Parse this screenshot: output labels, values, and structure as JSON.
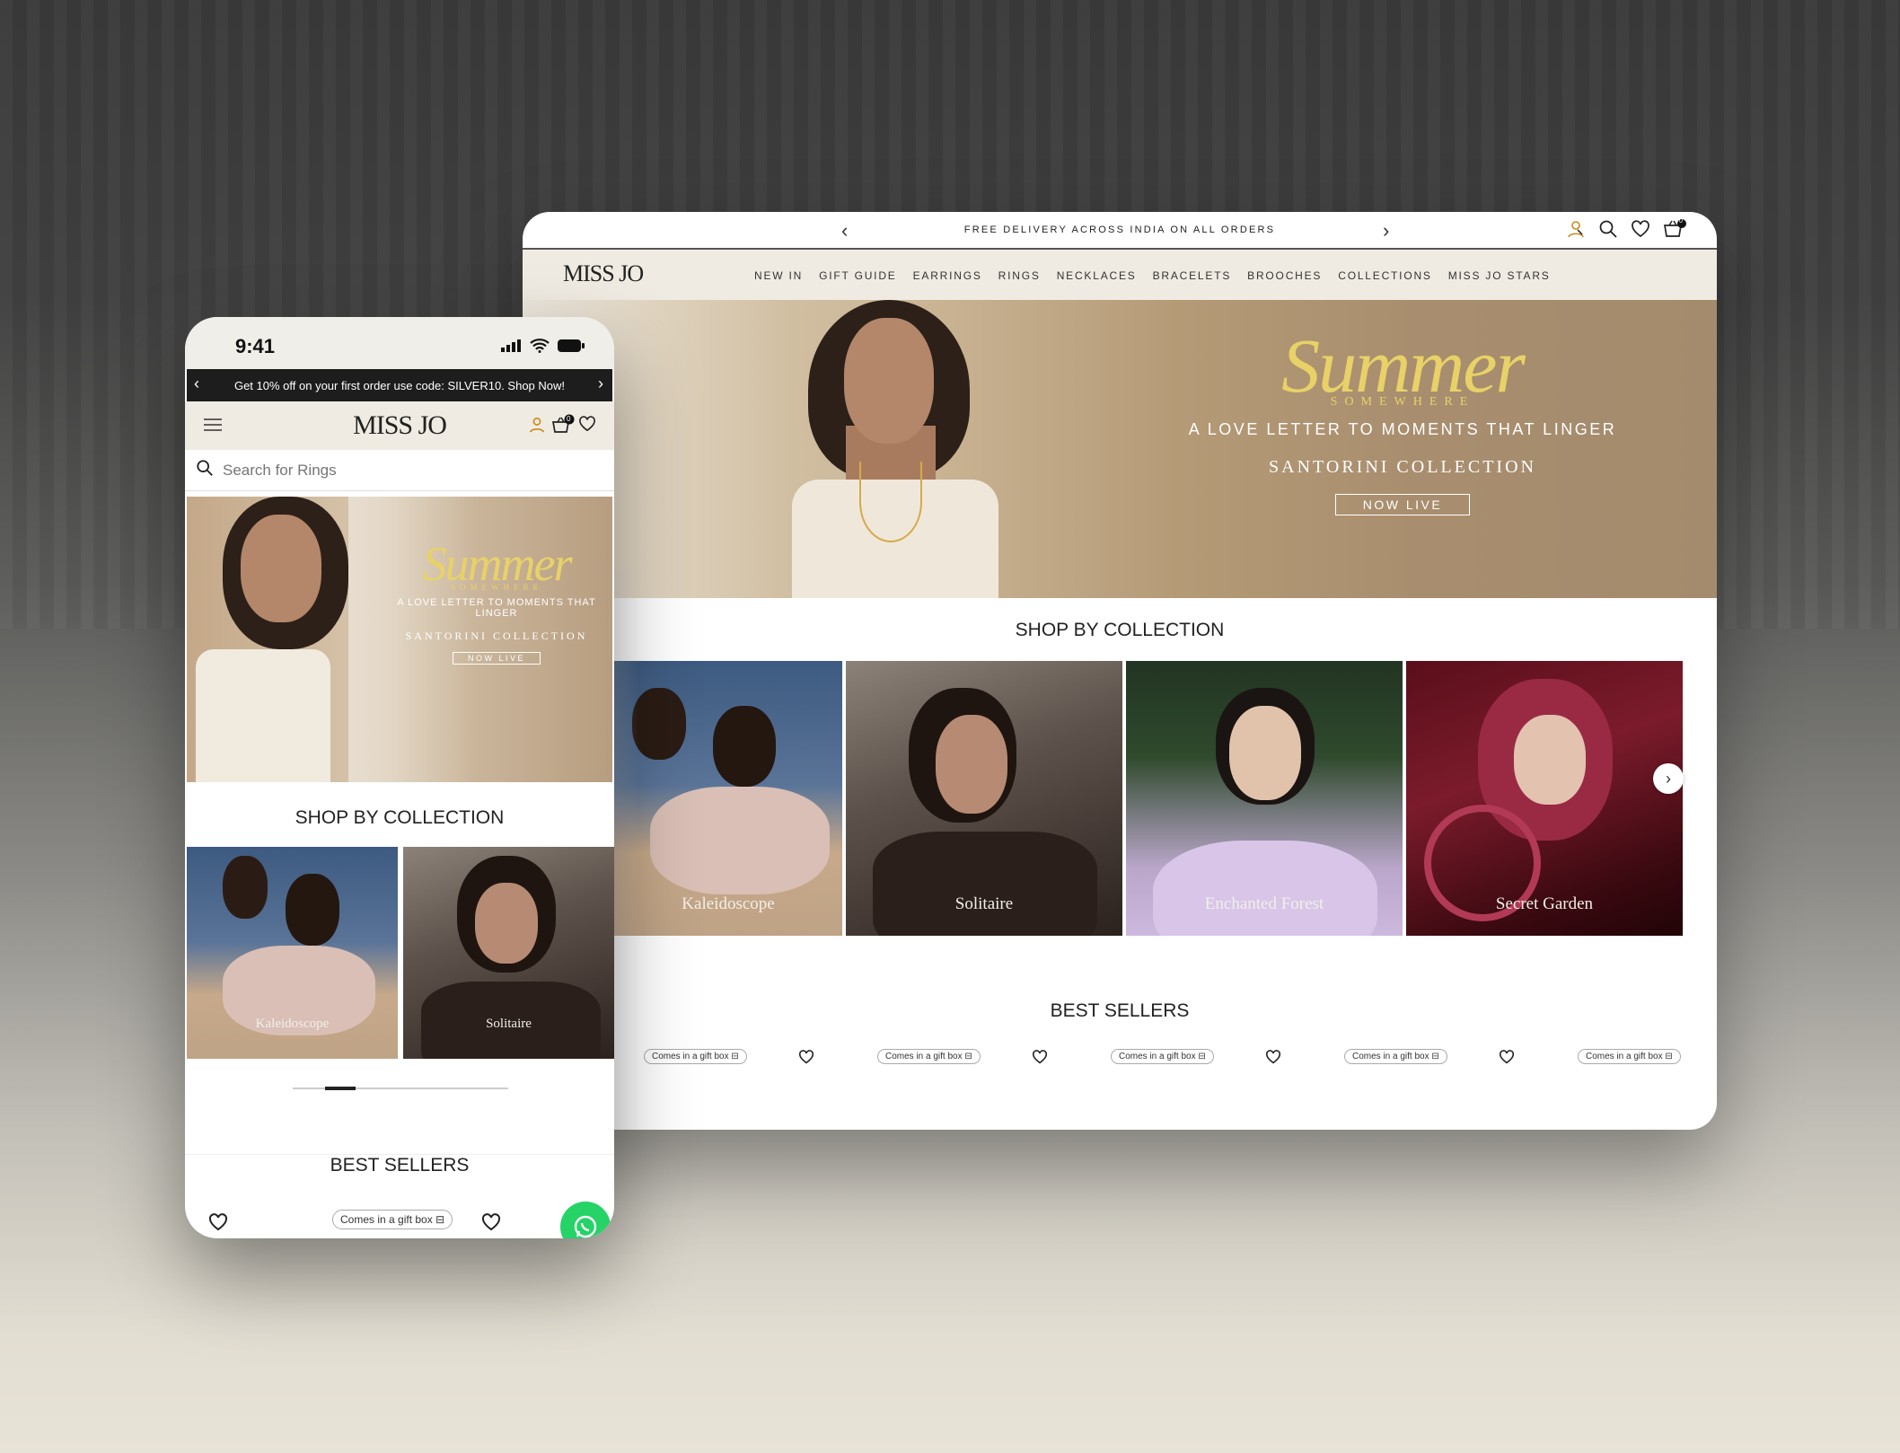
{
  "desktop": {
    "announcement": "FREE DELIVERY ACROSS INDIA ON ALL ORDERS",
    "prev_arrow": "‹",
    "next_arrow": "›",
    "cart_count": "0",
    "logo": "MISS JO",
    "menu": [
      "NEW IN",
      "GIFT GUIDE",
      "EARRINGS",
      "RINGS",
      "NECKLACES",
      "BRACELETS",
      "BROOCHES",
      "COLLECTIONS",
      "MISS JO STARS"
    ],
    "hero": {
      "script_title": "Summer",
      "script_sub": "SOMEWHERE",
      "tagline": "A LOVE LETTER TO MOMENTS THAT LINGER",
      "collection": "SANTORINI COLLECTION",
      "cta": "NOW LIVE"
    },
    "shop_by_collection": "SHOP BY COLLECTION",
    "collections": [
      "Kaleidoscope",
      "Solitaire",
      "Enchanted Forest",
      "Secret Garden"
    ],
    "carousel_next": "›",
    "best_sellers": "BEST SELLERS",
    "gift_badge": "Comes in a gift box"
  },
  "mobile": {
    "time": "9:41",
    "announcement": "Get 10% off on your first order use code: SILVER10. Shop Now!",
    "prev_arrow": "‹",
    "next_arrow": "›",
    "logo": "MISS JO",
    "cart_count": "0",
    "search_placeholder": "Search for Rings",
    "hero": {
      "script_title": "Summer",
      "script_sub": "SOMEWHERE",
      "tagline": "A LOVE LETTER TO MOMENTS THAT LINGER",
      "collection": "SANTORINI COLLECTION",
      "cta": "NOW LIVE"
    },
    "shop_by_collection": "SHOP BY COLLECTION",
    "collections": [
      "Kaleidoscope",
      "Solitaire"
    ],
    "best_sellers": "BEST SELLERS",
    "gift_badge": "Comes in a gift box"
  },
  "colors": {
    "nav_bg": "#f0ebe2",
    "hero_gold": "#e8d268",
    "whatsapp": "#25d366",
    "promo_bar": "#1d1d1d"
  },
  "icons": [
    "account-icon",
    "search-icon",
    "wishlist-icon",
    "cart-icon",
    "hamburger-icon",
    "heart-icon",
    "gift-icon",
    "whatsapp-icon",
    "chevron-left-icon",
    "chevron-right-icon"
  ]
}
